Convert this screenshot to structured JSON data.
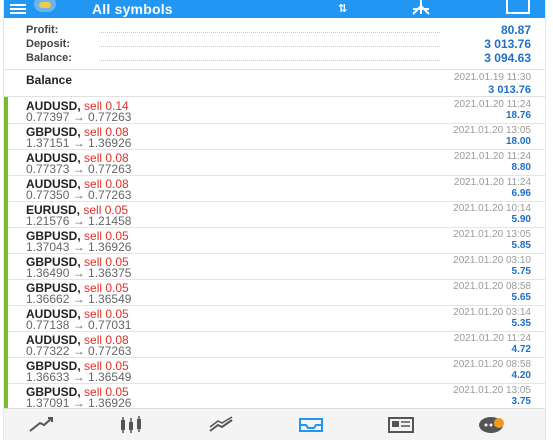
{
  "topbar": {
    "title": "All symbols",
    "sort_glyph": "⇅",
    "icons": [
      "menu-icon",
      "logo-icon",
      "sort-icon",
      "new-trade-icon",
      "calculator-icon"
    ]
  },
  "summary": {
    "profit_label": "Profit:",
    "profit_value": "80.87",
    "deposit_label": "Deposit:",
    "deposit_value": "3 013.76",
    "balance_label": "Balance:",
    "balance_value": "3 094.63"
  },
  "balance_entry": {
    "label": "Balance",
    "time": "2021.01.19 11:30",
    "amount": "3 013.76"
  },
  "trades": [
    {
      "symbol": "AUDUSD,",
      "side": "sell 0.14",
      "prices": "0.77397 → 0.77263",
      "time": "2021.01.20 11:24",
      "profit": "18.76"
    },
    {
      "symbol": "GBPUSD,",
      "side": "sell 0.08",
      "prices": "1.37151 → 1.36926",
      "time": "2021.01.20 13:05",
      "profit": "18.00"
    },
    {
      "symbol": "AUDUSD,",
      "side": "sell 0.08",
      "prices": "0.77373 → 0.77263",
      "time": "2021.01.20 11:24",
      "profit": "8.80"
    },
    {
      "symbol": "AUDUSD,",
      "side": "sell 0.08",
      "prices": "0.77350 → 0.77263",
      "time": "2021.01.20 11:24",
      "profit": "6.96"
    },
    {
      "symbol": "EURUSD,",
      "side": "sell 0.05",
      "prices": "1.21576 → 1.21458",
      "time": "2021.01.20 10:14",
      "profit": "5.90"
    },
    {
      "symbol": "GBPUSD,",
      "side": "sell 0.05",
      "prices": "1.37043 → 1.36926",
      "time": "2021.01.20 13:05",
      "profit": "5.85"
    },
    {
      "symbol": "GBPUSD,",
      "side": "sell 0.05",
      "prices": "1.36490 → 1.36375",
      "time": "2021.01.20 03:10",
      "profit": "5.75"
    },
    {
      "symbol": "GBPUSD,",
      "side": "sell 0.05",
      "prices": "1.36662 → 1.36549",
      "time": "2021.01.20 08:58",
      "profit": "5.65"
    },
    {
      "symbol": "AUDUSD,",
      "side": "sell 0.05",
      "prices": "0.77138 → 0.77031",
      "time": "2021.01.20 03:14",
      "profit": "5.35"
    },
    {
      "symbol": "AUDUSD,",
      "side": "sell 0.08",
      "prices": "0.77322 → 0.77263",
      "time": "2021.01.20 11:24",
      "profit": "4.72"
    },
    {
      "symbol": "GBPUSD,",
      "side": "sell 0.05",
      "prices": "1.36633 → 1.36549",
      "time": "2021.01.20 08:58",
      "profit": "4.20"
    },
    {
      "symbol": "GBPUSD,",
      "side": "sell 0.05",
      "prices": "1.37091 → 1.36926",
      "time": "2021.01.20 13:05",
      "profit": "3.75"
    }
  ],
  "bottom_nav": {
    "items": [
      "quotes-icon",
      "chart-icon",
      "trade-icon",
      "history-icon",
      "news-icon",
      "chat-icon"
    ],
    "active": "history-icon"
  },
  "colors": {
    "header": "#2196f3",
    "profit_blue": "#1e6fc8",
    "sell_red": "#e0302a",
    "row_bar_green": "#7cbb2e",
    "badge_orange": "#f39a1e"
  }
}
